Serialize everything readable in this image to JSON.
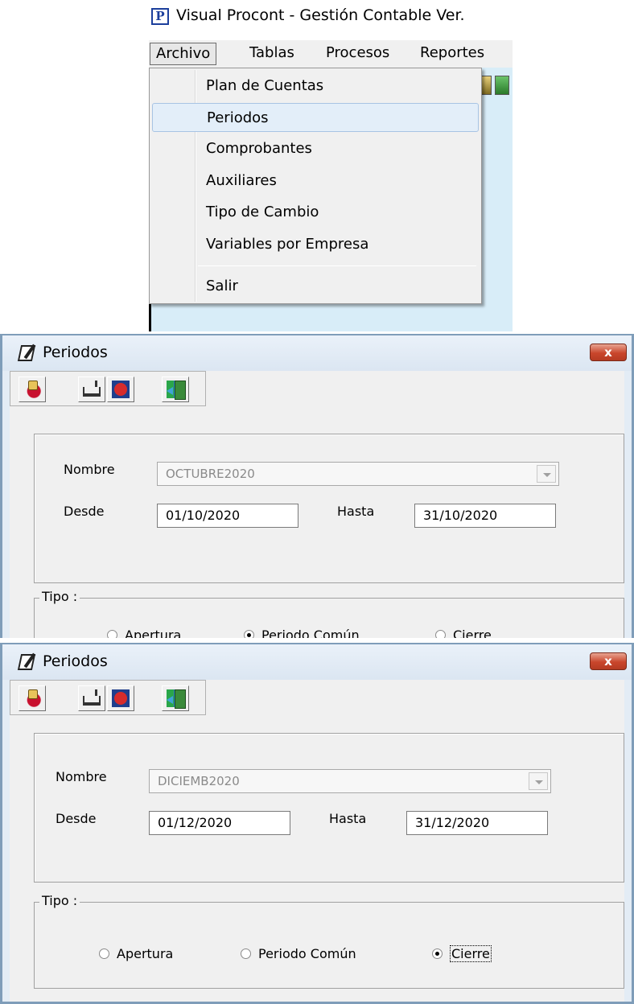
{
  "app": {
    "title": "Visual Procont - Gestión Contable Ver.",
    "icon_letter": "P",
    "menubar": [
      "Archivo",
      "Tablas",
      "Procesos",
      "Reportes"
    ],
    "open_menu": {
      "items": [
        "Plan de Cuentas",
        "Periodos",
        "Comprobantes",
        "Auxiliares",
        "Tipo de Cambio",
        "Variables por Empresa"
      ],
      "highlighted": "Periodos",
      "exit_item": "Salir"
    }
  },
  "dialog1": {
    "title": "Periodos",
    "close": "x",
    "nombre_label": "Nombre",
    "nombre_value": "OCTUBRE2020",
    "desde_label": "Desde",
    "desde_value": "01/10/2020",
    "hasta_label": "Hasta",
    "hasta_value": "31/10/2020",
    "tipo_label": "Tipo :",
    "radio_apertura": "Apertura",
    "radio_comun": "Periodo Común",
    "radio_cierre": "Cierre",
    "selected": "Periodo Común"
  },
  "dialog2": {
    "title": "Periodos",
    "close": "x",
    "nombre_label": "Nombre",
    "nombre_value": "DICIEMB2020",
    "desde_label": "Desde",
    "desde_value": "01/12/2020",
    "hasta_label": "Hasta",
    "hasta_value": "31/12/2020",
    "tipo_label": "Tipo :",
    "radio_apertura": "Apertura",
    "radio_comun": "Periodo Común",
    "radio_cierre": "Cierre",
    "selected": "Cierre"
  },
  "icons": [
    "app-logo-icon",
    "notepad-pen-icon",
    "new-record-icon",
    "save-disk-icon",
    "cancel-icon",
    "exit-door-icon",
    "close-icon",
    "dropdown-arrow-icon"
  ]
}
